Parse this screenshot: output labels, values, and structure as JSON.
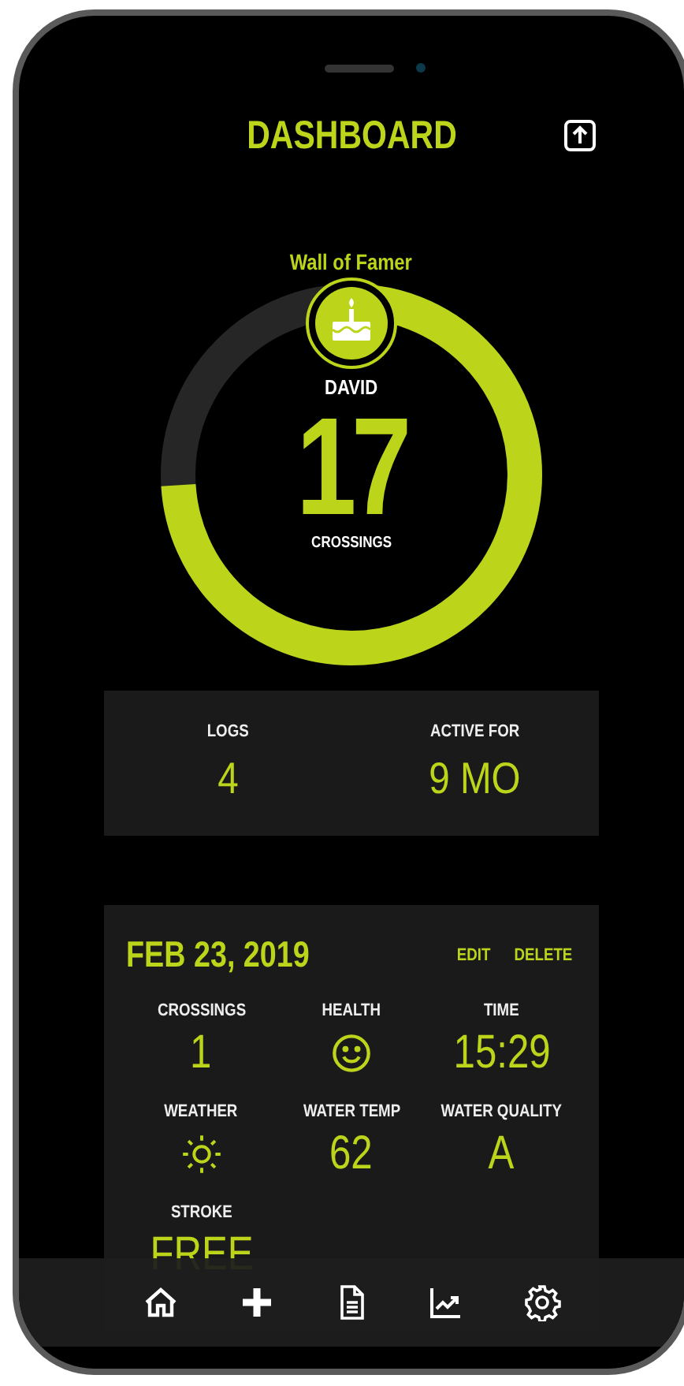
{
  "header": {
    "title": "DASHBOARD"
  },
  "profile": {
    "rank": "Wall of Famer",
    "name": "DAVID",
    "count": "17",
    "count_label": "CROSSINGS",
    "level": 0.74
  },
  "summary": [
    {
      "label": "LOGS",
      "value": "4"
    },
    {
      "label": "ACTIVE FOR",
      "value": "9 MO"
    }
  ],
  "log": {
    "date": "FEB 23, 2019",
    "actions": [
      "EDIT",
      "DELETE"
    ],
    "fields": [
      {
        "label": "CROSSINGS",
        "kind": "text",
        "value": "1"
      },
      {
        "label": "HEALTH",
        "kind": "smiley"
      },
      {
        "label": "TIME",
        "kind": "text",
        "value": "15:29"
      },
      {
        "label": "WEATHER",
        "kind": "sun"
      },
      {
        "label": "WATER TEMP",
        "kind": "text",
        "value": "62"
      },
      {
        "label": "WATER QUALITY",
        "kind": "text",
        "value": "A"
      },
      {
        "label": "STROKE",
        "kind": "text",
        "value": "FREE"
      }
    ]
  }
}
